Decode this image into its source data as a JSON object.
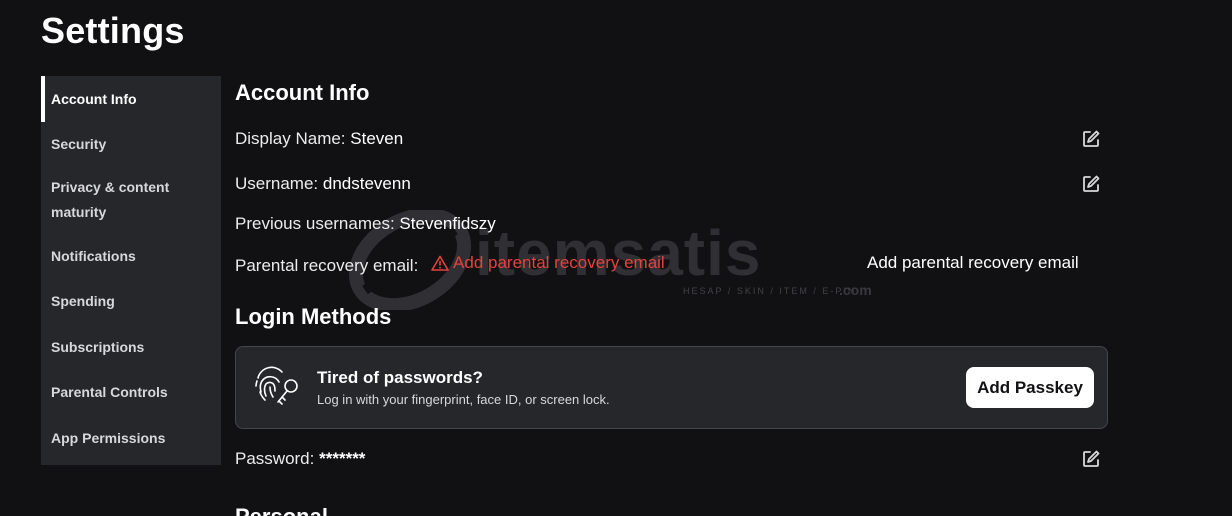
{
  "page": {
    "title": "Settings"
  },
  "sidebar": {
    "items": [
      {
        "label": "Account Info",
        "active": true
      },
      {
        "label": "Security"
      },
      {
        "label": "Privacy & content maturity"
      },
      {
        "label": "Notifications"
      },
      {
        "label": "Spending"
      },
      {
        "label": "Subscriptions"
      },
      {
        "label": "Parental Controls"
      },
      {
        "label": "App Permissions"
      }
    ]
  },
  "account": {
    "section_title": "Account Info",
    "display_name_label": "Display Name:",
    "display_name_value": "Steven",
    "username_label": "Username:",
    "username_value": "dndstevenn",
    "previous_usernames_label": "Previous usernames:",
    "previous_usernames_value": "Stevenfidszy",
    "parental_email_label": "Parental recovery email:",
    "parental_email_warning": "Add parental recovery email",
    "add_parental_email_link": "Add parental recovery email"
  },
  "login": {
    "section_title": "Login Methods",
    "passkey_title": "Tired of passwords?",
    "passkey_subtitle": "Log in with your fingerprint, face ID, or screen lock.",
    "add_passkey_label": "Add Passkey",
    "password_label": "Password:",
    "password_value": "*******"
  },
  "personal": {
    "section_title": "Personal"
  },
  "watermark": {
    "brand": "itemsatis",
    "tagline": "HESAP / SKIN / ITEM / E-PIN",
    "suffix": ".com"
  },
  "icons": {
    "edit": "edit-pencil-icon",
    "warning": "warning-triangle-icon",
    "passkey": "fingerprint-key-icon"
  },
  "colors": {
    "background": "#111113",
    "sidebar": "#26272b",
    "warning": "#e5423c",
    "button": "#ffffff"
  }
}
